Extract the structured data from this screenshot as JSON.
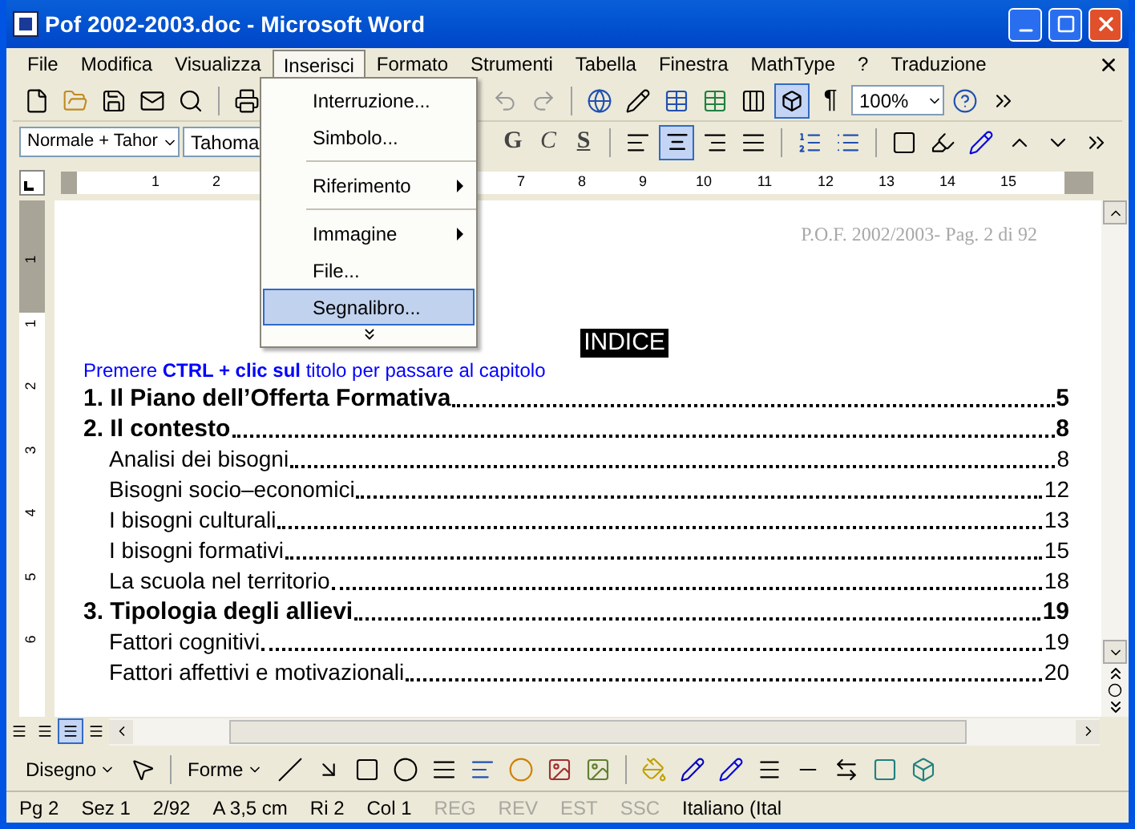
{
  "window": {
    "title": "Pof 2002-2003.doc - Microsoft Word"
  },
  "menu_bar": [
    {
      "label": "File",
      "selected": false
    },
    {
      "label": "Modifica",
      "selected": false
    },
    {
      "label": "Visualizza",
      "selected": false
    },
    {
      "label": "Inserisci",
      "selected": true
    },
    {
      "label": "Formato",
      "selected": false
    },
    {
      "label": "Strumenti",
      "selected": false
    },
    {
      "label": "Tabella",
      "selected": false
    },
    {
      "label": "Finestra",
      "selected": false
    },
    {
      "label": "MathType",
      "selected": false
    },
    {
      "label": "?",
      "selected": false
    },
    {
      "label": "Traduzione",
      "selected": false
    }
  ],
  "standard_toolbar": {
    "zoom": "100%",
    "pilcrow": "¶"
  },
  "formatting_toolbar": {
    "style": "Normale + Tahor",
    "font": "Tahoma",
    "bold": "G",
    "italic": "C",
    "underline": "S"
  },
  "insert_menu": [
    {
      "label": "Interruzione...",
      "kind": "item",
      "selected": false
    },
    {
      "label": "Simbolo...",
      "kind": "item",
      "selected": false
    },
    {
      "kind": "separator"
    },
    {
      "label": "Riferimento",
      "kind": "submenu",
      "selected": false
    },
    {
      "kind": "separator"
    },
    {
      "label": "Immagine",
      "kind": "submenu",
      "selected": false
    },
    {
      "label": "File...",
      "kind": "item",
      "selected": false
    },
    {
      "label": "Segnalibro...",
      "kind": "item",
      "selected": true
    },
    {
      "kind": "more"
    }
  ],
  "ruler": {
    "left_numbers": [
      "1",
      "2"
    ],
    "right_numbers": [
      "7",
      "8",
      "9",
      "10",
      "11",
      "12",
      "13",
      "14",
      "15"
    ],
    "vertical_numbers": [
      "1",
      "1",
      "2",
      "3",
      "4",
      "5",
      "6"
    ]
  },
  "document": {
    "header": "P.O.F. 2002/2003- Pag.  2  di  92",
    "heading": "INDICE",
    "hint": "Premere **CTRL + clic sul** titolo per passare al capitolo",
    "toc": [
      {
        "kind": "chapter",
        "text": "1. Il Piano dell’Offerta Formativa",
        "page": "5"
      },
      {
        "kind": "chapter",
        "text": "2. Il contesto",
        "page": "8"
      },
      {
        "kind": "section",
        "text": "Analisi dei bisogni",
        "page": "8"
      },
      {
        "kind": "section",
        "text": "Bisogni socio–economici",
        "page": "12"
      },
      {
        "kind": "section",
        "text": "I bisogni culturali",
        "page": "13"
      },
      {
        "kind": "section",
        "text": "I bisogni formativi",
        "page": "15"
      },
      {
        "kind": "section",
        "text": "La scuola nel territorio",
        "page": "18"
      },
      {
        "kind": "chapter",
        "text": "3. Tipologia degli allievi",
        "page": "19"
      },
      {
        "kind": "section",
        "text": "Fattori cognitivi",
        "page": "19"
      },
      {
        "kind": "section",
        "text": "Fattori affettivi e motivazionali",
        "page": "20"
      }
    ]
  },
  "view_buttons": [
    {
      "selected": false
    },
    {
      "selected": false
    },
    {
      "selected": true
    },
    {
      "selected": false
    }
  ],
  "drawing_toolbar": {
    "draw": "Disegno",
    "shapes": "Forme"
  },
  "status_bar": [
    {
      "text": "Pg 2",
      "disabled": false
    },
    {
      "text": "Sez 1",
      "disabled": false
    },
    {
      "text": "2/92",
      "disabled": false
    },
    {
      "text": "A 3,5 cm",
      "disabled": false
    },
    {
      "text": "Ri 2",
      "disabled": false
    },
    {
      "text": "Col 1",
      "disabled": false
    },
    {
      "text": "REG",
      "disabled": true
    },
    {
      "text": "REV",
      "disabled": true
    },
    {
      "text": "EST",
      "disabled": true
    },
    {
      "text": "SSC",
      "disabled": true
    },
    {
      "text": "Italiano (Ital",
      "disabled": false
    }
  ]
}
